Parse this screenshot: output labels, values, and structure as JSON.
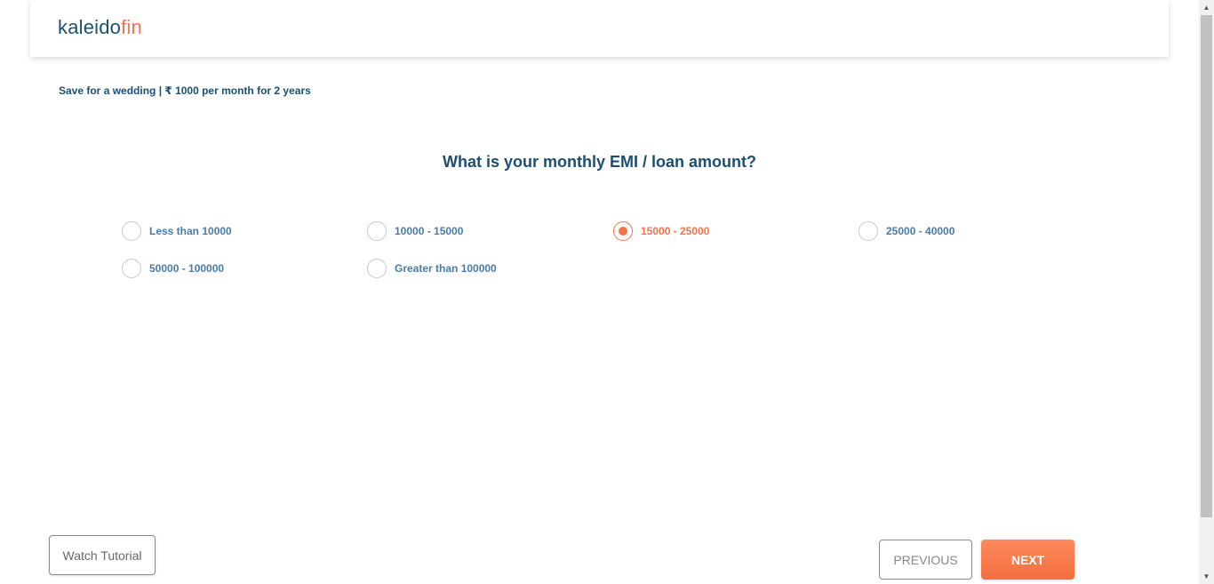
{
  "logo": {
    "part1": "kaleido",
    "part2": "fin"
  },
  "goal_summary": "Save for a wedding | ₹ 1000 per month for 2 years",
  "question": "What is your monthly EMI / loan amount?",
  "options": [
    {
      "label": "Less than 10000",
      "selected": false
    },
    {
      "label": "10000 - 15000",
      "selected": false
    },
    {
      "label": "15000 - 25000",
      "selected": true
    },
    {
      "label": "25000 - 40000",
      "selected": false
    },
    {
      "label": "50000 - 100000",
      "selected": false
    },
    {
      "label": "Greater than 100000",
      "selected": false
    }
  ],
  "buttons": {
    "watch_tutorial": "Watch Tutorial",
    "previous": "PREVIOUS",
    "next": "NEXT"
  },
  "colors": {
    "primary": "#1b4f72",
    "accent": "#f2734a",
    "option_text": "#4a7aa8"
  },
  "icons": {
    "scroll_up": "▲",
    "scroll_down": "▼"
  }
}
